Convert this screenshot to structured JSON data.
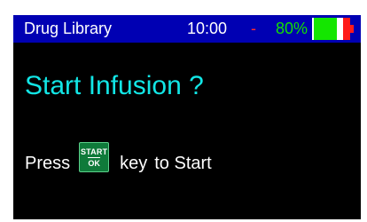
{
  "status_bar": {
    "title": "Drug Library",
    "time": "10:00",
    "separator": "-",
    "battery_percent_label": "80%",
    "battery_level": 0.8,
    "colors": {
      "background": "#0000b3",
      "text": "#ffffff",
      "separator": "#ff2a2a",
      "battery_text": "#13e000",
      "battery_fill": "#14e600",
      "battery_low": "#ff1a1a"
    }
  },
  "main": {
    "prompt": "Start Infusion ?",
    "prompt_color": "#12e6e6",
    "instruction": {
      "press": "Press",
      "key_icon_name": "start-ok-key-icon",
      "key_top_label": "START",
      "key_bottom_label": "OK",
      "key_color": "#0f7a3a",
      "after_key": "key",
      "to_start": "to Start"
    }
  }
}
